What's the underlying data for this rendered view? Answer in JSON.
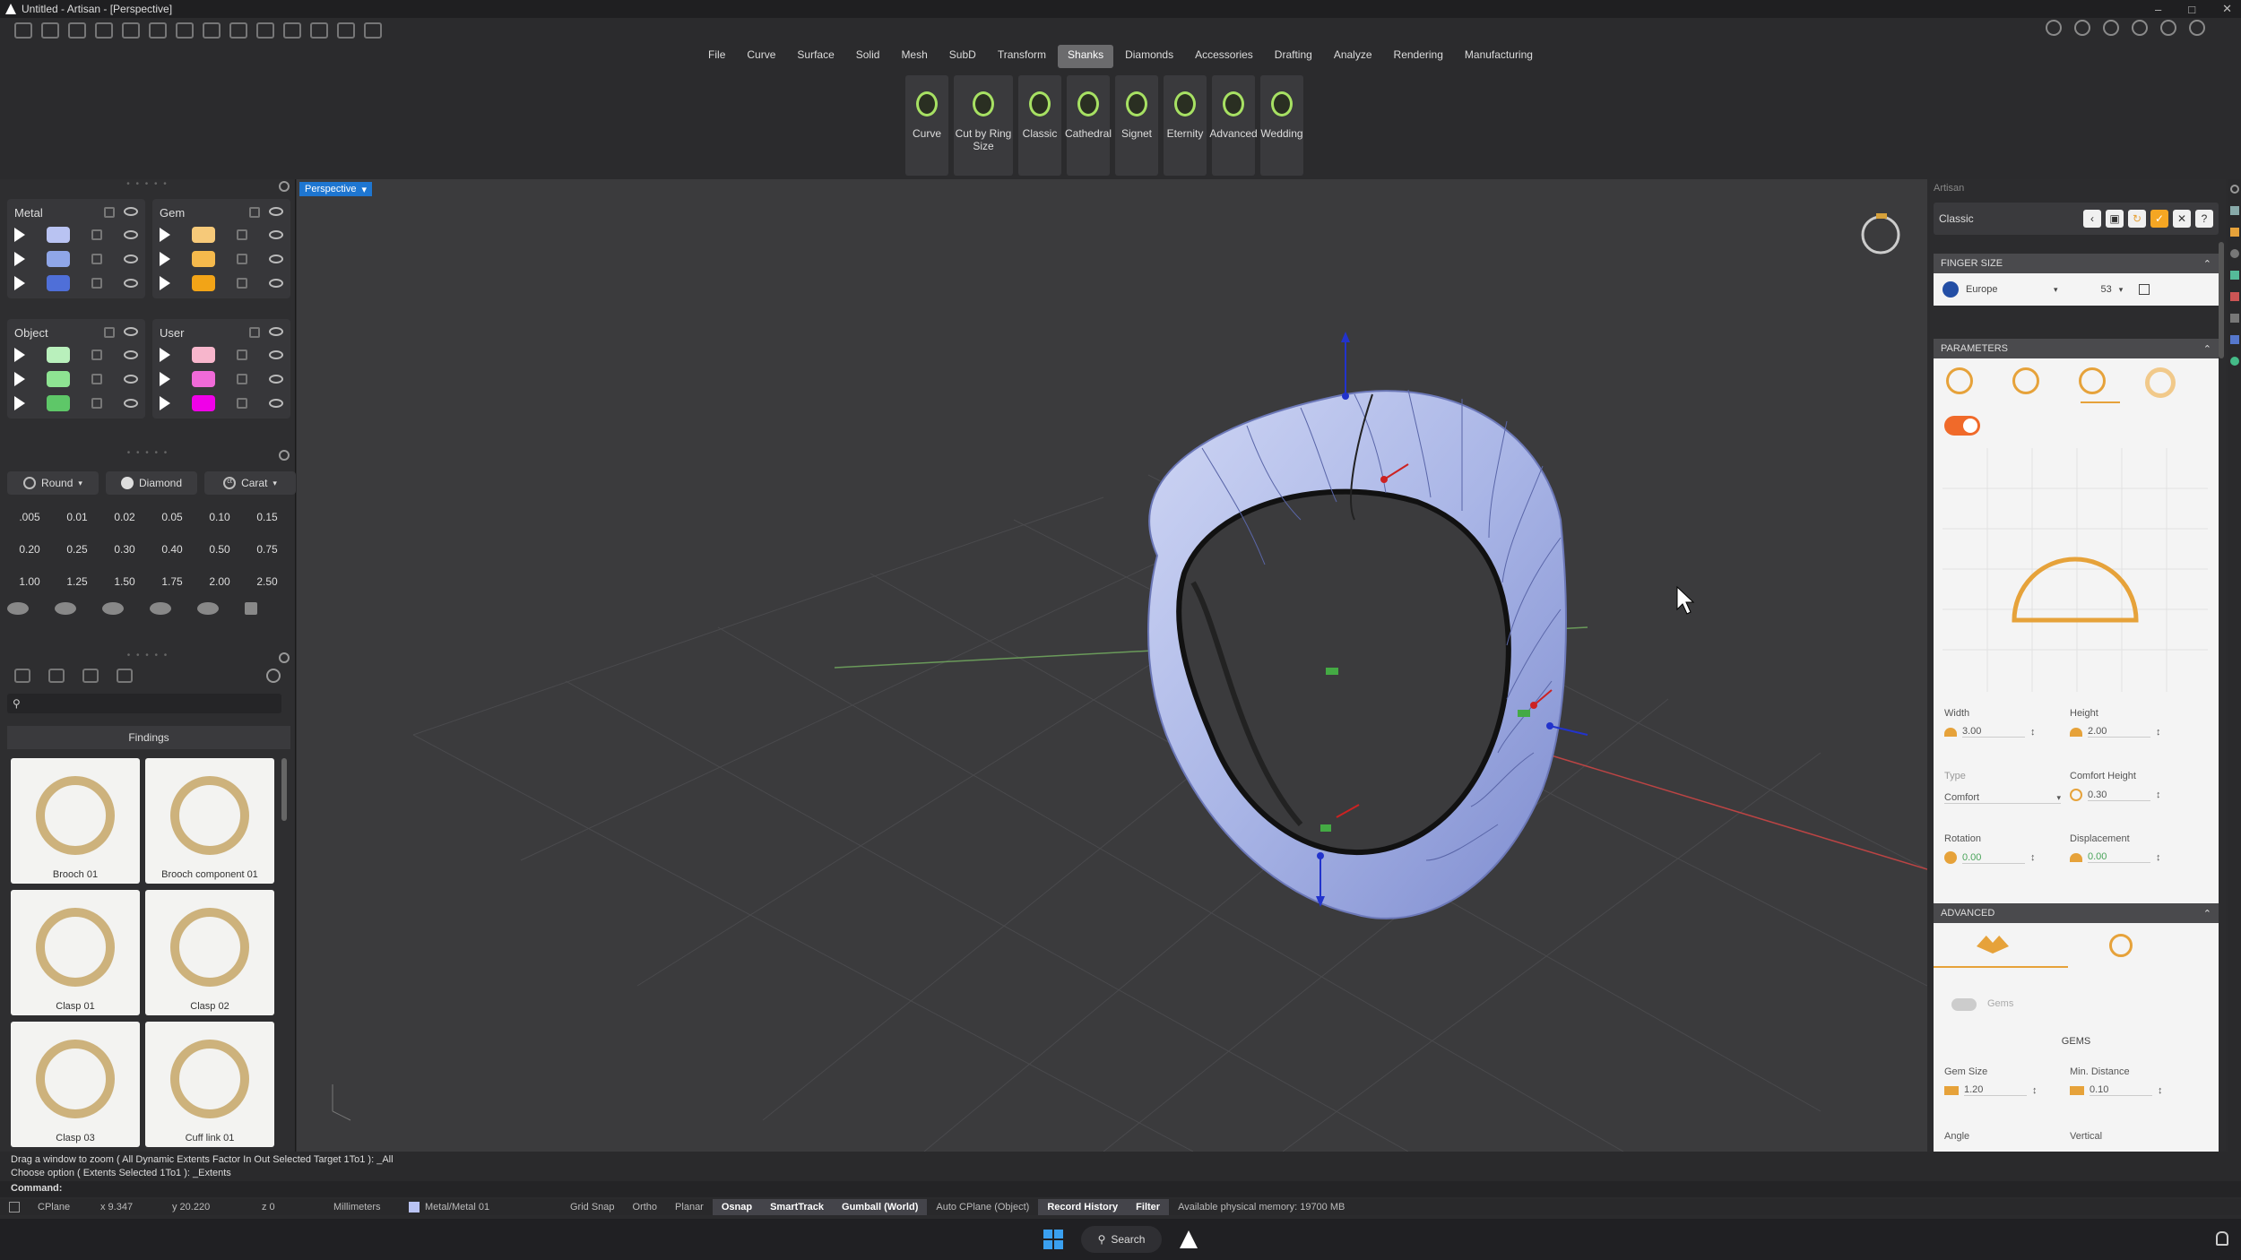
{
  "window": {
    "title": "Untitled - Artisan - [Perspective]"
  },
  "menu": [
    "File",
    "Curve",
    "Surface",
    "Solid",
    "Mesh",
    "SubD",
    "Transform",
    "Shanks",
    "Diamonds",
    "Accessories",
    "Drafting",
    "Analyze",
    "Rendering",
    "Manufacturing"
  ],
  "menu_active": "Shanks",
  "ribbon": [
    {
      "label": "Curve",
      "icon": "curve-shank-icon"
    },
    {
      "label": "Cut by Ring Size",
      "icon": "cut-ring-icon"
    },
    {
      "label": "Classic",
      "icon": "classic-shank-icon"
    },
    {
      "label": "Cathedral",
      "icon": "cathedral-shank-icon"
    },
    {
      "label": "Signet",
      "icon": "signet-shank-icon"
    },
    {
      "label": "Eternity",
      "icon": "eternity-shank-icon"
    },
    {
      "label": "Advanced",
      "icon": "advanced-shank-icon"
    },
    {
      "label": "Wedding",
      "icon": "wedding-shank-icon"
    }
  ],
  "layers": {
    "metal": {
      "title": "Metal",
      "colors": [
        "#b9c3f2",
        "#8fa6e8",
        "#4f6fd8"
      ]
    },
    "gem": {
      "title": "Gem",
      "colors": [
        "#f6c979",
        "#f5b94c",
        "#f2a417"
      ]
    },
    "object": {
      "title": "Object",
      "colors": [
        "#b9f0bc",
        "#8ee492",
        "#5ec768"
      ]
    },
    "user": {
      "title": "User",
      "colors": [
        "#f7b6cc",
        "#f06ad8",
        "#f000e8"
      ]
    }
  },
  "gem_picker": {
    "shape": "Round",
    "type": "Diamond",
    "unit": "Carat",
    "values": [
      ".005",
      "0.01",
      "0.02",
      "0.05",
      "0.10",
      "0.15",
      "0.20",
      "0.25",
      "0.30",
      "0.40",
      "0.50",
      "0.75",
      "1.00",
      "1.25",
      "1.50",
      "1.75",
      "2.00",
      "2.50"
    ]
  },
  "library": {
    "category": "Findings",
    "search_placeholder": "",
    "items": [
      "Brooch 01",
      "Brooch component 01",
      "Clasp 01",
      "Clasp 02",
      "Clasp 03",
      "Cuff link 01"
    ]
  },
  "viewport": {
    "name": "Perspective"
  },
  "artisan": {
    "panel_title": "Artisan",
    "preset": "Classic",
    "finger_size": {
      "header": "FINGER SIZE",
      "standard": "Europe",
      "size": "53"
    },
    "parameters": {
      "header": "PARAMETERS",
      "width_label": "Width",
      "width": "3.00",
      "height_label": "Height",
      "height": "2.00",
      "type_label": "Type",
      "type": "Comfort",
      "comfort_height_label": "Comfort Height",
      "comfort_height": "0.30",
      "rotation_label": "Rotation",
      "rotation": "0.00",
      "displacement_label": "Displacement",
      "displacement": "0.00"
    },
    "advanced": {
      "header": "ADVANCED",
      "gems_toggle": "Gems",
      "gems_header": "GEMS",
      "gem_size_label": "Gem Size",
      "gem_size": "1.20",
      "min_distance_label": "Min. Distance",
      "min_distance": "0.10",
      "angle_label": "Angle",
      "vertical_label": "Vertical"
    }
  },
  "command": {
    "line1": "Drag a window to zoom ( All  Dynamic  Extents  Factor  In  Out  Selected  Target  1To1 ): _All",
    "line2": "Choose option ( Extents  Selected  1To1 ): _Extents",
    "prompt": "Command:"
  },
  "status": {
    "cplane": "CPlane",
    "x": "x 9.347",
    "y": "y 20.220",
    "z": "z 0",
    "units": "Millimeters",
    "layer": "Metal/Metal 01",
    "toggles": [
      "Grid Snap",
      "Ortho",
      "Planar",
      "Osnap",
      "SmartTrack",
      "Gumball (World)",
      "Auto CPlane (Object)",
      "Record History",
      "Filter"
    ],
    "toggles_on": [
      "Osnap",
      "SmartTrack",
      "Gumball (World)",
      "Record History",
      "Filter"
    ],
    "memory": "Available physical memory: 19700 MB"
  },
  "taskbar": {
    "search": "Search"
  }
}
